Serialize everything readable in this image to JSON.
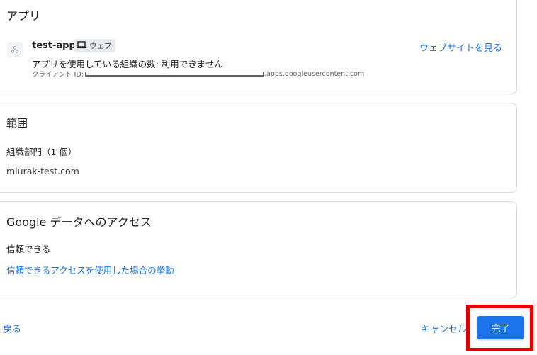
{
  "app_card": {
    "title": "アプリ",
    "app_name": "test-app",
    "type_chip": "ウェブ",
    "usage_text": "アプリを使用している組織の数: 利用できません",
    "client_id_label": "クライアント ID:",
    "client_id_suffix": ".apps.googleusercontent.com",
    "view_site_label": "ウェブサイトを見る",
    "icons": {
      "app": "app-placeholder-icon",
      "chip": "laptop-icon"
    }
  },
  "scope_card": {
    "title": "範囲",
    "label": "組織部門（1 個）",
    "domain": "miurak-test.com"
  },
  "access_card": {
    "title": "Google データへのアクセス",
    "status": "信頼できる",
    "link_label": "信頼できるアクセスを使用した場合の挙動"
  },
  "footer": {
    "back_label": "戻る",
    "cancel_label": "キャンセル",
    "done_label": "完了"
  },
  "colors": {
    "accent": "#1a73e8",
    "highlight": "#e00000",
    "border": "#dadce0"
  }
}
